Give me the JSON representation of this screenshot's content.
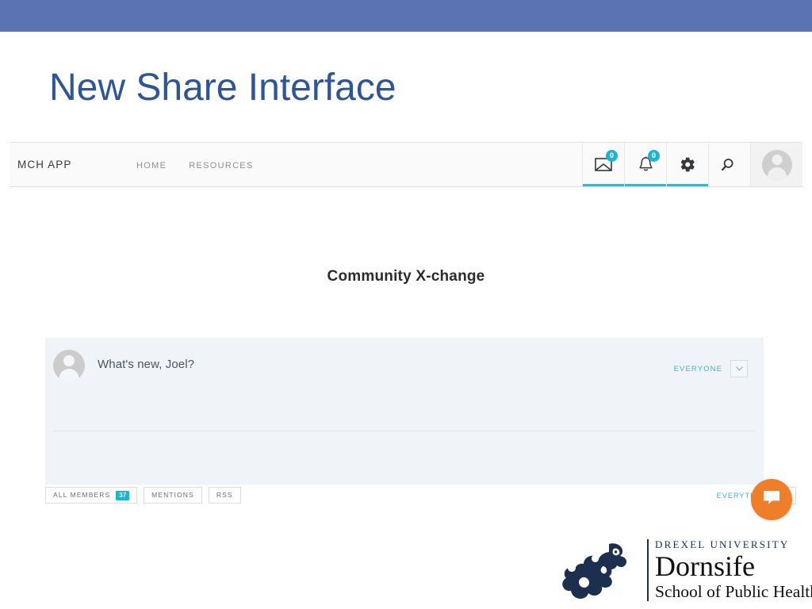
{
  "slide": {
    "title": "New Share Interface",
    "banner_color": "#5b73b3",
    "title_color": "#2d5597"
  },
  "app": {
    "brand": "MCH APP",
    "nav_links": [
      {
        "label": "HOME"
      },
      {
        "label": "RESOURCES"
      }
    ],
    "icons": [
      {
        "name": "mail-icon",
        "badge": "0"
      },
      {
        "name": "notifications-bell-icon",
        "badge": "0"
      },
      {
        "name": "settings-gear-icon",
        "badge": null
      },
      {
        "name": "search-icon",
        "badge": null
      },
      {
        "name": "user-avatar",
        "badge": null
      }
    ],
    "accent_color": "#1fb3d3",
    "underline_color": "#46b0c6"
  },
  "main": {
    "heading": "Community X-change",
    "share": {
      "placeholder": "What's new, Joel?",
      "privacy_label": "EVERYONE",
      "privacy_caret": "˅"
    },
    "toolbar": {
      "left_buttons": [
        {
          "label": "ALL MEMBERS",
          "badge": "37"
        },
        {
          "label": "MENTIONS",
          "badge": null
        },
        {
          "label": "RSS",
          "badge": null
        }
      ],
      "scope_label": "EVERYTHING",
      "scope_caret": "˅"
    },
    "chat_fab": {
      "name": "chat-bubble-icon",
      "color": "#ef7e2a"
    }
  },
  "logo": {
    "line1": "DREXEL UNIVERSITY",
    "line2": "Dornsife",
    "line3": "School of Public Health",
    "color": "#1c2f4e"
  }
}
